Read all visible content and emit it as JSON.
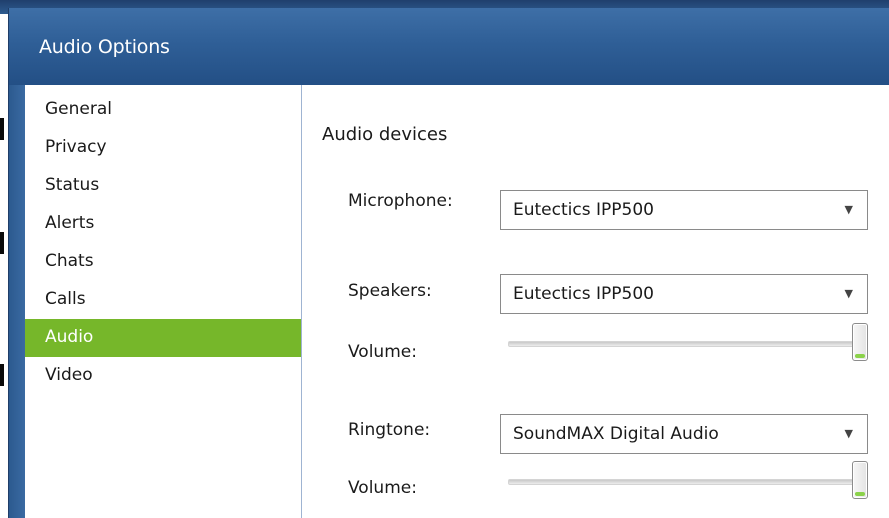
{
  "window": {
    "title": "Audio Options"
  },
  "sidebar": {
    "items": [
      {
        "label": "General"
      },
      {
        "label": "Privacy"
      },
      {
        "label": "Status"
      },
      {
        "label": "Alerts"
      },
      {
        "label": "Chats"
      },
      {
        "label": "Calls"
      },
      {
        "label": "Audio",
        "active": true
      },
      {
        "label": "Video"
      }
    ]
  },
  "main": {
    "section_title": "Audio devices",
    "microphone": {
      "label": "Microphone:",
      "value": "Eutectics IPP500"
    },
    "speakers": {
      "label": "Speakers:",
      "value": "Eutectics IPP500",
      "volume_label": "Volume:",
      "volume_level": 1.0
    },
    "ringtone": {
      "label": "Ringtone:",
      "value": "SoundMAX Digital Audio",
      "volume_label": "Volume:",
      "volume_level": 1.0
    }
  },
  "colors": {
    "title_bar": "#2f5f97",
    "accent_selected": "#76b72a",
    "slider_indicator": "#8bd24a"
  },
  "icons": {
    "dropdown": "chevron-down-icon"
  }
}
